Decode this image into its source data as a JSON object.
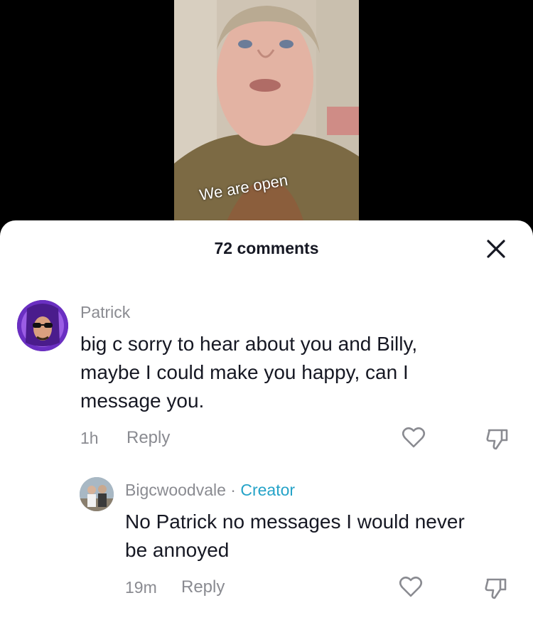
{
  "video": {
    "caption": "We are open"
  },
  "sheet": {
    "title": "72 comments",
    "close_icon": "close-icon"
  },
  "comments": [
    {
      "username": "Patrick",
      "text_lines": [
        "big c sorry to hear about you and Billy,",
        "maybe I could make you happy, can I",
        "message you."
      ],
      "time": "1h",
      "reply_label": "Reply",
      "like_icon": "heart-outline-icon",
      "dislike_icon": "thumbs-down-icon"
    },
    {
      "username": "Bigcwoodvale",
      "separator": " · ",
      "badge": "Creator",
      "text_lines": [
        "No Patrick no messages I would never",
        "be annoyed"
      ],
      "time": "19m",
      "reply_label": "Reply",
      "like_icon": "heart-outline-icon",
      "dislike_icon": "thumbs-down-icon"
    }
  ]
}
